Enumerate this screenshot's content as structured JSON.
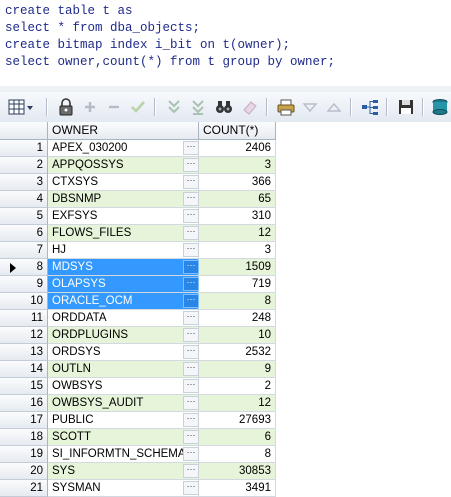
{
  "editor": {
    "lines": [
      "create table t as",
      "select * from dba_objects;",
      "create bitmap index i_bit on t(owner);",
      "select owner,count(*) from t group by owner;"
    ]
  },
  "toolbar": {
    "icons": [
      "grid-menu-icon",
      "lock-icon",
      "add-icon",
      "remove-icon",
      "check-icon",
      "down-double-icon",
      "down-double-alt-icon",
      "binoculars-icon",
      "eraser-icon",
      "print-icon",
      "triangle-down-icon",
      "triangle-up-icon",
      "tree-icon",
      "save-icon",
      "export-icon"
    ]
  },
  "grid": {
    "columns": [
      "OWNER",
      "COUNT(*)"
    ],
    "rows": [
      {
        "n": "1",
        "owner": "APEX_030200",
        "count": "2406"
      },
      {
        "n": "2",
        "owner": "APPQOSSYS",
        "count": "3"
      },
      {
        "n": "3",
        "owner": "CTXSYS",
        "count": "366"
      },
      {
        "n": "4",
        "owner": "DBSNMP",
        "count": "65"
      },
      {
        "n": "5",
        "owner": "EXFSYS",
        "count": "310"
      },
      {
        "n": "6",
        "owner": "FLOWS_FILES",
        "count": "12"
      },
      {
        "n": "7",
        "owner": "HJ",
        "count": "3"
      },
      {
        "n": "8",
        "owner": "MDSYS",
        "count": "1509"
      },
      {
        "n": "9",
        "owner": "OLAPSYS",
        "count": "719"
      },
      {
        "n": "10",
        "owner": "ORACLE_OCM",
        "count": "8"
      },
      {
        "n": "11",
        "owner": "ORDDATA",
        "count": "248"
      },
      {
        "n": "12",
        "owner": "ORDPLUGINS",
        "count": "10"
      },
      {
        "n": "13",
        "owner": "ORDSYS",
        "count": "2532"
      },
      {
        "n": "14",
        "owner": "OUTLN",
        "count": "9"
      },
      {
        "n": "15",
        "owner": "OWBSYS",
        "count": "2"
      },
      {
        "n": "16",
        "owner": "OWBSYS_AUDIT",
        "count": "12"
      },
      {
        "n": "17",
        "owner": "PUBLIC",
        "count": "27693"
      },
      {
        "n": "18",
        "owner": "SCOTT",
        "count": "6"
      },
      {
        "n": "19",
        "owner": "SI_INFORMTN_SCHEMA",
        "count": "8"
      },
      {
        "n": "20",
        "owner": "SYS",
        "count": "30853"
      },
      {
        "n": "21",
        "owner": "SYSMAN",
        "count": "3491"
      }
    ],
    "selected_rows": [
      8,
      9,
      10
    ],
    "current_row": 8
  },
  "colors": {
    "selection": "#3399ff",
    "alt_row": "#e6f4d9",
    "sql_text": "#1f2b8a"
  }
}
